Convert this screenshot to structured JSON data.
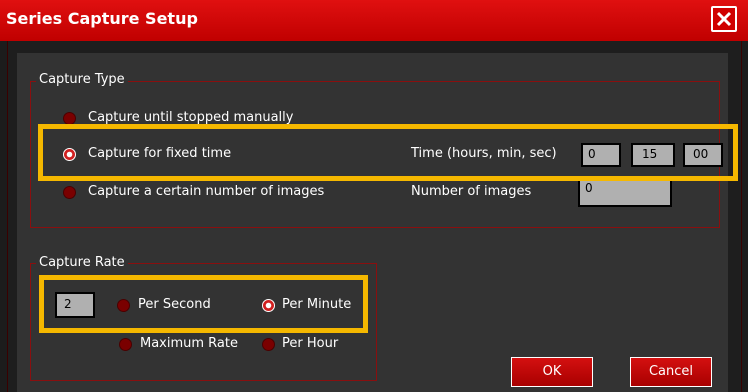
{
  "window": {
    "title": "Series Capture Setup"
  },
  "capture_type": {
    "legend": "Capture Type",
    "options": [
      {
        "label": "Capture until stopped manually",
        "selected": false
      },
      {
        "label": "Capture for fixed time",
        "selected": true
      },
      {
        "label": "Capture a certain number of images",
        "selected": false
      }
    ],
    "time_label": "Time (hours, min, sec)",
    "time_hours": "0",
    "time_minutes": "15",
    "time_seconds": "00",
    "images_label": "Number of images",
    "images_value": "0"
  },
  "capture_rate": {
    "legend": "Capture Rate",
    "value": "2",
    "options": [
      {
        "label": "Per Second",
        "selected": false
      },
      {
        "label": "Per Minute",
        "selected": true
      },
      {
        "label": "Maximum Rate",
        "selected": false
      },
      {
        "label": "Per Hour",
        "selected": false
      }
    ]
  },
  "buttons": {
    "ok": "OK",
    "cancel": "Cancel"
  },
  "colors": {
    "titlebar": "#d00000",
    "highlight": "#f5b800",
    "group_border": "#8a0f0f",
    "button": "#c00000"
  }
}
